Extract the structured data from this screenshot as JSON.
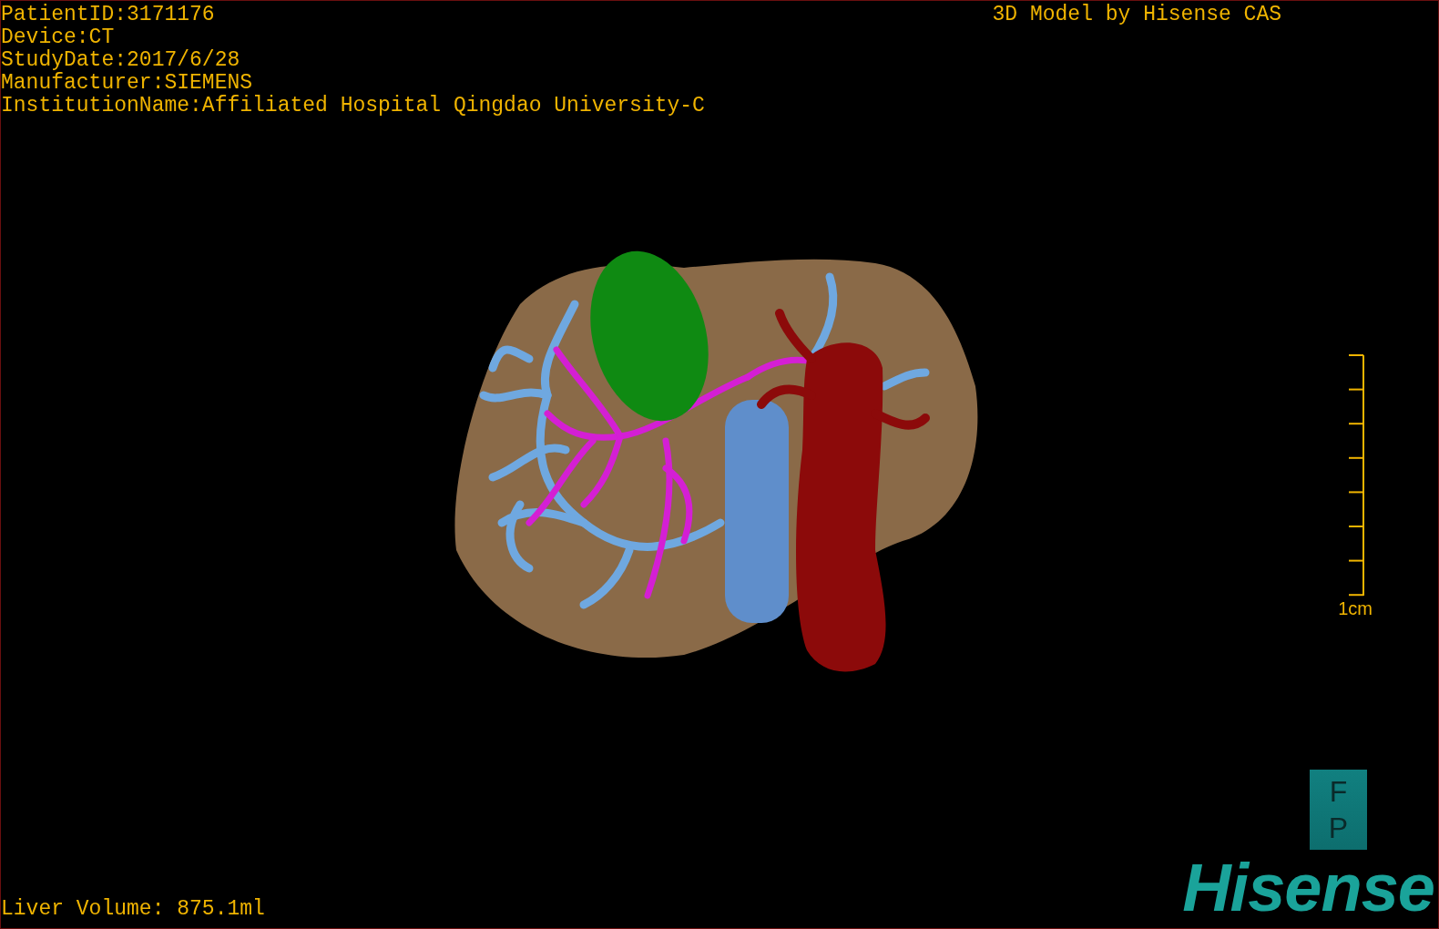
{
  "info_lines": [
    "PatientID:3171176",
    "Device:CT",
    "StudyDate:2017/6/28",
    "Manufacturer:SIEMENS",
    "InstitutionName:Affiliated Hospital Qingdao University-C"
  ],
  "title": "3D Model by Hisense CAS",
  "scale_bar": {
    "label": "1cm"
  },
  "orientation": {
    "labels": [
      "F",
      "P"
    ]
  },
  "liver_volume": "Liver Volume: 875.1ml",
  "logo": "Hisense"
}
